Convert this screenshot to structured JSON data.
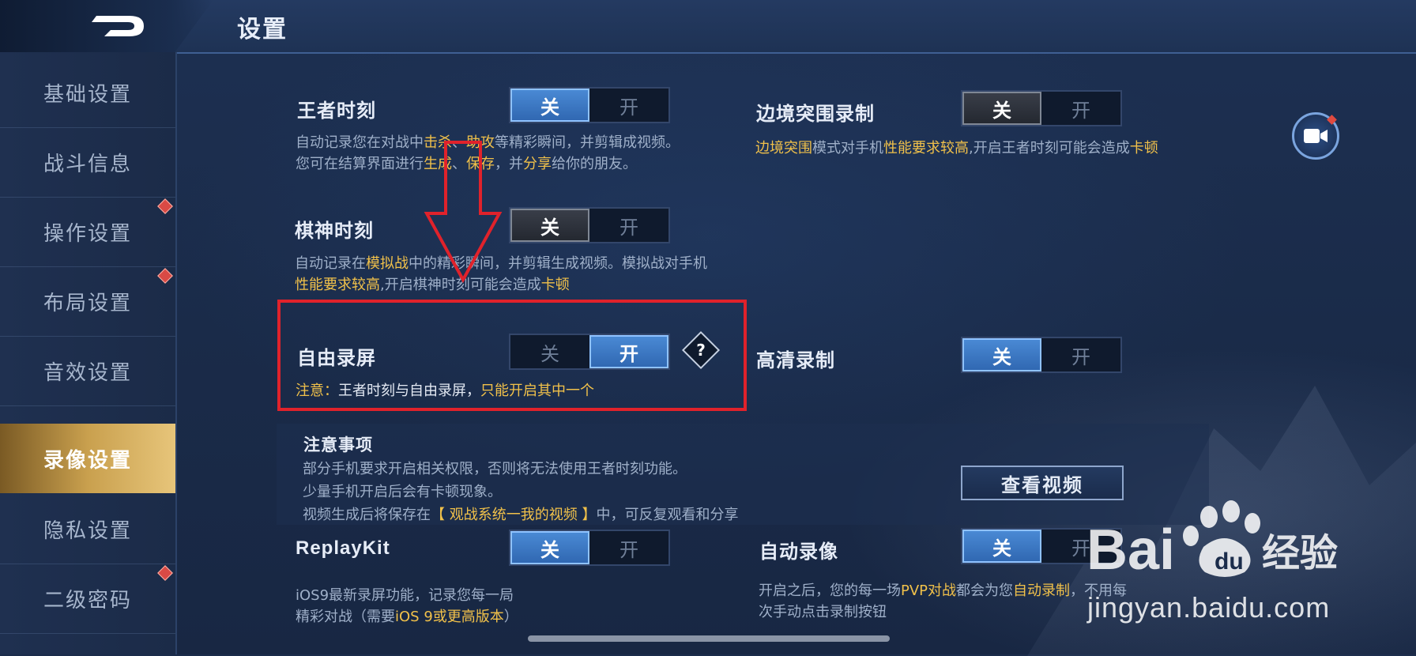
{
  "header": {
    "title": "设置"
  },
  "sidebar": {
    "items": [
      {
        "label": "基础设置",
        "badge": false
      },
      {
        "label": "战斗信息",
        "badge": false
      },
      {
        "label": "操作设置",
        "badge": true
      },
      {
        "label": "布局设置",
        "badge": true
      },
      {
        "label": "音效设置",
        "badge": false
      },
      {
        "label": "录像设置",
        "badge": false,
        "active": true
      },
      {
        "label": "隐私设置",
        "badge": false
      },
      {
        "label": "二级密码",
        "badge": true
      }
    ]
  },
  "settings": {
    "wangzhe_moment": {
      "label": "王者时刻",
      "off": "关",
      "on": "开",
      "selected": "关",
      "desc1_a": "自动记录您在对战中",
      "desc1_b": "击杀",
      "desc1_c": "、",
      "desc1_d": "助攻",
      "desc1_e": "等精彩瞬间，并剪辑成视频。",
      "desc2_a": "您可在结算界面进行",
      "desc2_b": "生成",
      "desc2_c": "、",
      "desc2_d": "保存",
      "desc2_e": "，并",
      "desc2_f": "分享",
      "desc2_g": "给你的朋友。"
    },
    "border_record": {
      "label": "边境突围录制",
      "off": "关",
      "on": "开",
      "selected": "关",
      "desc_a": "边境突围",
      "desc_b": "模式对手机",
      "desc_c": "性能要求较高",
      "desc_d": ",开启王者时刻可能会造成",
      "desc_e": "卡顿"
    },
    "chess_moment": {
      "label": "棋神时刻",
      "off": "关",
      "on": "开",
      "selected": "关",
      "desc1_a": "自动记录在",
      "desc1_b": "模拟战",
      "desc1_c": "中的精彩瞬间，并剪辑生成视频。模拟战对手机",
      "desc2_a": "性能要求较高",
      "desc2_b": ",开启棋神时刻可能会造成",
      "desc2_c": "卡顿"
    },
    "free_record": {
      "label": "自由录屏",
      "off": "关",
      "on": "开",
      "selected": "开",
      "help": "?",
      "note_a": "注意：",
      "note_b": "王者时刻与自由录屏，",
      "note_c": "只能开启其中一个"
    },
    "hd_record": {
      "label": "高清录制",
      "off": "关",
      "on": "开",
      "selected": "关"
    },
    "notice": {
      "title": "注意事项",
      "line1": "部分手机要求开启相关权限，否则将无法使用王者时刻功能。",
      "line2": "少量手机开启后会有卡顿现象。",
      "line3_a": "视频生成后将保存在",
      "line3_b": "【 观战系统一我的视频 】",
      "line3_c": "中，可反复观看和分享",
      "view_button": "查看视频"
    },
    "replaykit": {
      "label": "ReplayKit",
      "off": "关",
      "on": "开",
      "selected": "关",
      "desc1": "iOS9最新录屏功能，记录您每一局",
      "desc2_a": "精彩对战（需要",
      "desc2_b": "iOS 9或更高版本",
      "desc2_c": "）"
    },
    "auto_record": {
      "label": "自动录像",
      "off": "关",
      "on": "开",
      "selected": "关",
      "desc1_a": "开启之后，您的每一场",
      "desc1_b": "PVP对战",
      "desc1_c": "都会为您",
      "desc1_d": "自动录制",
      "desc1_e": "，不用每",
      "desc2": "次手动点击录制按钮"
    }
  },
  "watermark": {
    "logo_text": "Bai",
    "logo_text2": "经验",
    "url": "jingyan.baidu.com"
  },
  "colors": {
    "highlight": "#f1c14a",
    "active_toggle": "#3b78c8",
    "annotation_red": "#e0222b",
    "active_sidebar": "#c9a04e"
  }
}
